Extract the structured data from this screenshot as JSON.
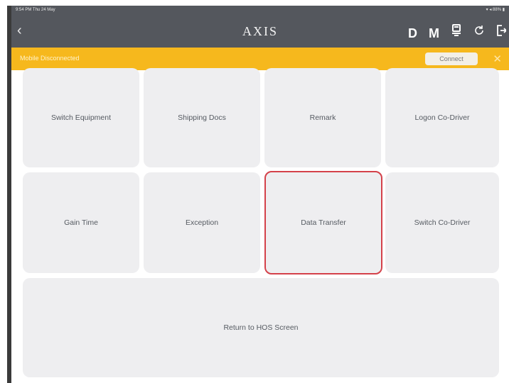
{
  "statusbar": {
    "left": "9:54 PM  Thu 24 May",
    "right": "▾ ◂ 88% ▮"
  },
  "navbar": {
    "back_icon": "chevron-left-icon",
    "title": "AXIS",
    "icons": [
      "D",
      "M"
    ]
  },
  "banner": {
    "message": "Mobile Disconnected",
    "connect_label": "Connect",
    "close_icon": "close-icon"
  },
  "tiles": [
    {
      "label": "Switch Equipment"
    },
    {
      "label": "Shipping Docs"
    },
    {
      "label": "Remark"
    },
    {
      "label": "Logon Co-Driver"
    },
    {
      "label": "Gain Time"
    },
    {
      "label": "Exception"
    },
    {
      "label": "Data Transfer"
    },
    {
      "label": "Switch Co-Driver"
    },
    {
      "label": "Return to HOS Screen"
    }
  ],
  "colors": {
    "navbar": "#54575d",
    "banner": "#f6b81d",
    "tile": "#eeeef0",
    "selected_border": "#d4414a"
  }
}
